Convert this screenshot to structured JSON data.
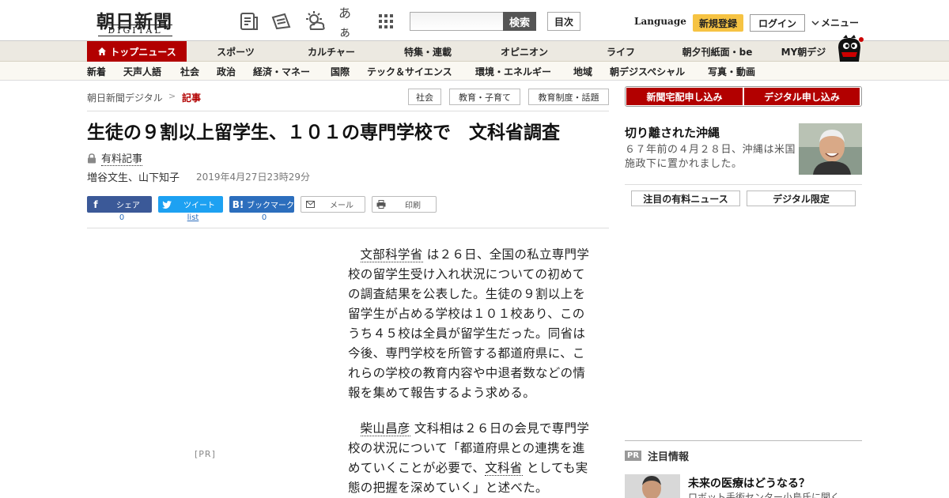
{
  "header": {
    "logo_main": "朝日新聞",
    "logo_sub": "DIGITAL",
    "icons": [
      "paper-icon",
      "megaphone-icon",
      "weather-icon",
      "font-size-icon",
      "grid-icon"
    ],
    "font_size_glyph": "あぁ",
    "search_placeholder": "",
    "search_button": "検索",
    "index_button": "目次",
    "language_link": "Language",
    "signup_button": "新規登録",
    "login_button": "ログイン",
    "menu_button": "メニュー"
  },
  "main_nav": {
    "top_news": "トップニュース",
    "items": [
      "スポーツ",
      "カルチャー",
      "特集・連載",
      "オピニオン",
      "ライフ",
      "朝夕刊紙面・be",
      "MY朝デジ"
    ]
  },
  "sub_nav": {
    "items": [
      "新着",
      "天声人語",
      "社会",
      "政治",
      "経済・マネー",
      "国際",
      "テック＆サイエンス",
      "環境・エネルギー",
      "地域",
      "朝デジスペシャル",
      "写真・動画"
    ]
  },
  "breadcrumb": {
    "home": "朝日新聞デジタル",
    "separator": ">",
    "current": "記事"
  },
  "tags": [
    "社会",
    "教育・子育て",
    "教育制度・話題"
  ],
  "article": {
    "headline": "生徒の９割以上留学生、１０１の専門学校で　文科省調査",
    "paid_label": "有料記事",
    "authors": "増谷文生、山下知子",
    "datetime": "2019年4月27日23時29分",
    "share": {
      "facebook_label": "シェア",
      "facebook_count": "0",
      "twitter_label": "ツイート",
      "twitter_count": "list",
      "hatena_label": "ブックマーク",
      "hatena_count": "0",
      "mail_label": "メール",
      "print_label": "印刷"
    },
    "pr_label": "[PR]",
    "p1_kw": "文部科学省",
    "p1_rest": " は２６日、全国の私立専門学校の留学生受け入れ状況についての初めての調査結果を公表した。生徒の９割以上を留学生が占める学校は１０１校あり、このうち４５校は全員が留学生だった。同省は今後、専門学校を所管する都道府県に、これらの学校の教育内容や中退者数などの情報を集めて報告するよう求める。",
    "p2_kw1": "柴山昌彦",
    "p2_mid": " 文科相は２６日の会見で専門学校の状況について「都道府県との連携を進めていくことが必要で、",
    "p2_kw2": "文科省",
    "p2_end": " としても実態の把握を深めていく」と述べた。"
  },
  "right_column": {
    "home_delivery_button": "新聞宅配申し込み",
    "digital_button": "デジタル申し込み",
    "feature_title": "切り離された沖縄",
    "feature_text": "６７年前の４月２８日、沖縄は米国施政下に置かれました。",
    "tabs": [
      "注目の有料ニュース",
      "デジタル限定"
    ],
    "notice_badge": "PR",
    "notice_heading": "注目情報",
    "notice_title": "未来の医療はどうなる？",
    "notice_sub": "ロボット手術センター小島氏に聞く"
  },
  "colors": {
    "brand_red": "#b20000",
    "signup_yellow": "#f6c343",
    "facebook": "#3b5998",
    "twitter": "#1da1f2",
    "hatena": "#2c6ebd"
  }
}
